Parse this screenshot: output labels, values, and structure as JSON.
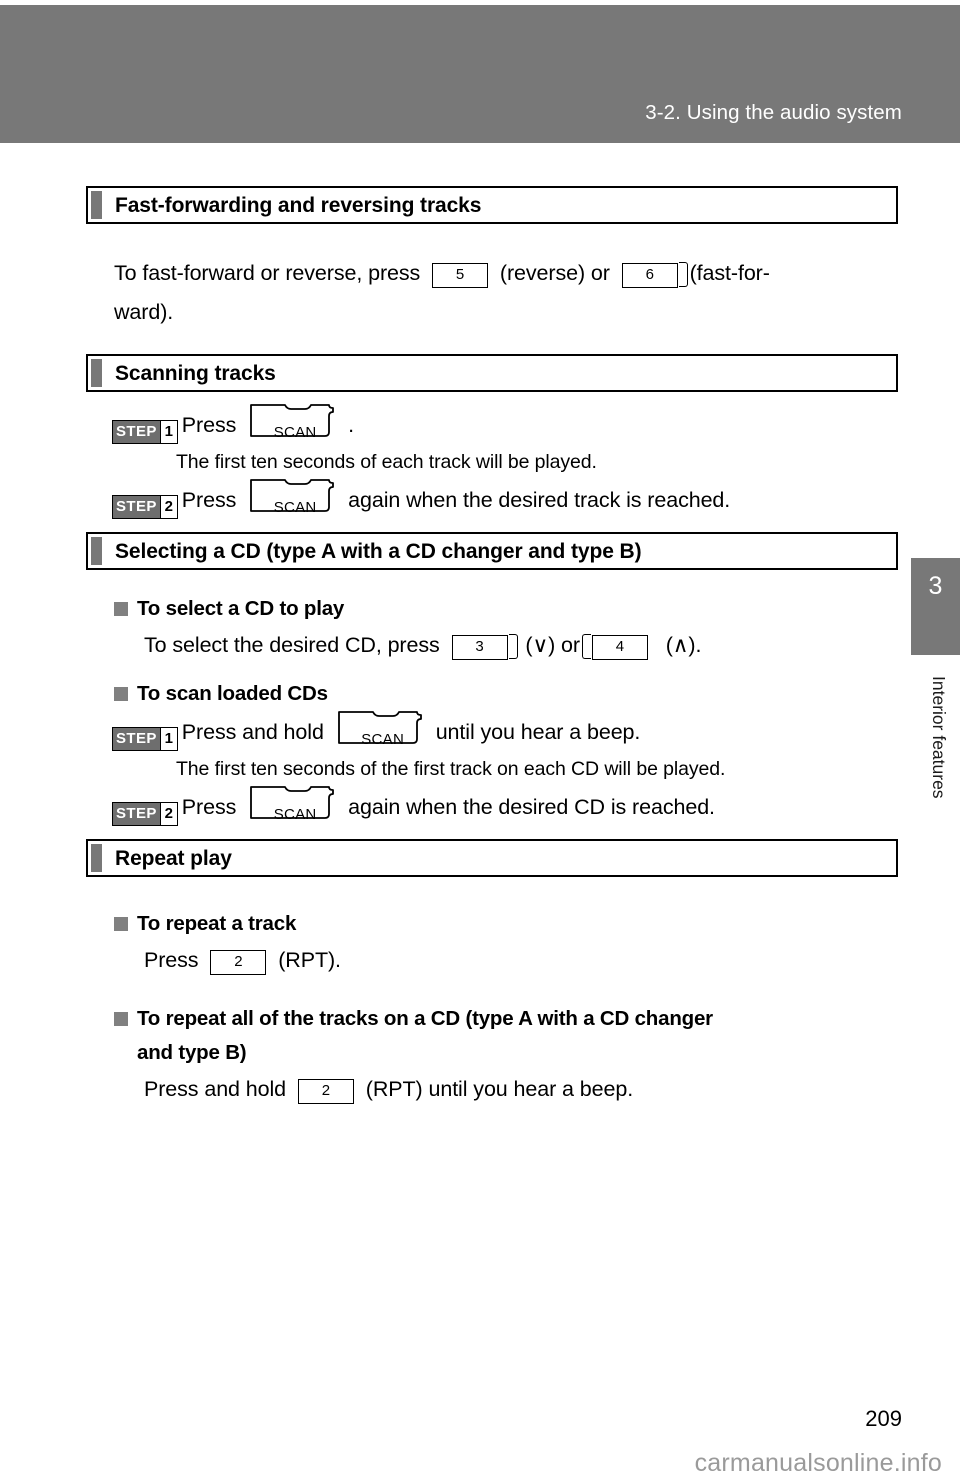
{
  "header": {
    "title": "3-2. Using the audio system",
    "band_color": "#787878"
  },
  "chapter_tab": {
    "number": "3",
    "name": "Interior features",
    "color": "#787878"
  },
  "sections": [
    {
      "id": "fast-forwarding",
      "title": "Fast-forwarding and reversing tracks",
      "body_before_key1": "To fast-forward or reverse, press",
      "key1": "5",
      "mid_text": "(reverse) or",
      "key2": "6",
      "body_after_key2": "(fast-for-",
      "line2": "ward)."
    },
    {
      "id": "scanning-tracks",
      "title": "Scanning tracks",
      "step1_word": "STEP",
      "step1_num": "1",
      "step1_text": "Press",
      "step1_button": "SCAN",
      "step1_trailing": ".",
      "step1_note": "The first ten seconds of each track will be played.",
      "step2_word": "STEP",
      "step2_num": "2",
      "step2_text": "Press",
      "step2_button": "SCAN",
      "step2_trailing": "again when the desired track is reached."
    },
    {
      "id": "selecting-cd",
      "title": "Selecting a CD (type A with a CD changer and type B)",
      "sub1_title": "To select a CD to play",
      "sub1_before_key1": "To select the desired CD, press",
      "sub1_key1": "3",
      "sub1_mid": "(∨) or",
      "sub1_key2": "4",
      "sub1_after": "(∧).",
      "sub2_title": "To scan loaded CDs",
      "sub2_step1_word": "STEP",
      "sub2_step1_num": "1",
      "sub2_step1_text": "Press and hold",
      "sub2_step1_button": "SCAN",
      "sub2_step1_trailing": "until you hear a beep.",
      "sub2_step1_note": "The first ten seconds of the first track on each CD will be played.",
      "sub2_step2_word": "STEP",
      "sub2_step2_num": "2",
      "sub2_step2_text": "Press",
      "sub2_step2_button": "SCAN",
      "sub2_step2_trailing": "again when the desired CD is reached."
    },
    {
      "id": "repeat-play",
      "title": "Repeat play",
      "sub1_title": "To repeat a track",
      "sub1_before_key": "Press",
      "sub1_key": "2",
      "sub1_after_key": "(RPT).",
      "sub2_title_line1": "To repeat all of the tracks on a CD (type A with a CD changer",
      "sub2_title_line2": "and type B)",
      "sub2_before_key": "Press and hold",
      "sub2_key": "2",
      "sub2_after_key": "(RPT) until you hear a beep."
    }
  ],
  "footer": {
    "page_number": "209",
    "watermark": "carmanualsonline.info"
  }
}
